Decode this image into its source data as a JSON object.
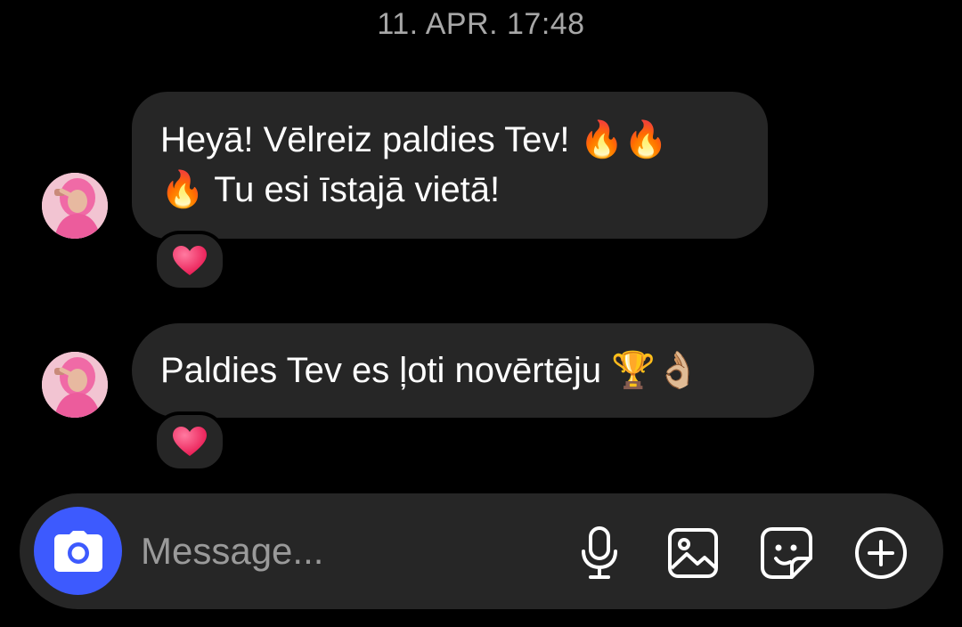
{
  "conversation": {
    "timestamp": "11. APR. 17:48",
    "messages": [
      {
        "line1_text": "Heyā! Vēlreiz paldies Tev! ",
        "line1_emoji": "🔥🔥",
        "line2_emoji": "🔥",
        "line2_text": " Tu esi īstajā vietā!",
        "reaction": "❤️"
      },
      {
        "text": "Paldies Tev es ļoti novērtēju ",
        "emoji": "🏆👌🏼",
        "reaction": "❤️"
      }
    ]
  },
  "composer": {
    "placeholder": "Message...",
    "icons": [
      "camera-icon",
      "microphone-icon",
      "gallery-icon",
      "sticker-icon",
      "add-icon"
    ]
  },
  "colors": {
    "background": "#000000",
    "bubble": "#262626",
    "camera_button": "#3d5afe",
    "timestamp": "#a8a8a8",
    "placeholder": "#9a9a9a",
    "heart": "#ff2e63"
  }
}
